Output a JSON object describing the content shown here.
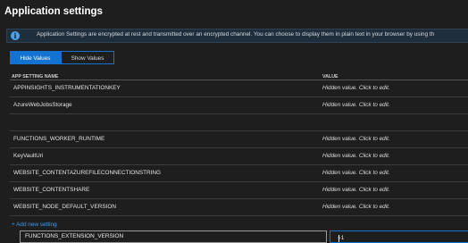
{
  "header": {
    "title": "Application settings"
  },
  "info_bar": {
    "icon": "info-icon",
    "text": "Application Settings are encrypted at rest and transmitted over an encrypted channel. You can choose to display them in plain text in your browser by using th"
  },
  "toggle": {
    "hide_label": "Hide Values",
    "show_label": "Show Values",
    "selected": "Hide Values"
  },
  "table": {
    "columns": {
      "name": "APP SETTING NAME",
      "value": "VALUE"
    },
    "rows": [
      {
        "name": "APPINSIGHTS_INSTRUMENTATIONKEY",
        "value": "Hidden value. Click to edit."
      },
      {
        "name": "AzureWebJobsStorage",
        "value": "Hidden value. Click to edit."
      },
      {
        "name": "FUNCTIONS_EXTENSION_VERSION",
        "value": "~1"
      },
      {
        "name": "FUNCTIONS_WORKER_RUNTIME",
        "value": "Hidden value. Click to edit."
      },
      {
        "name": "KeyVaultUri",
        "value": "Hidden value. Click to edit."
      },
      {
        "name": "WEBSITE_CONTENTAZUREFILECONNECTIONSTRING",
        "value": "Hidden value. Click to edit."
      },
      {
        "name": "WEBSITE_CONTENTSHARE",
        "value": "Hidden value. Click to edit."
      },
      {
        "name": "WEBSITE_NODE_DEFAULT_VERSION",
        "value": "Hidden value. Click to edit."
      }
    ]
  },
  "add_setting_label": "+ Add new setting",
  "colors": {
    "background": "#1e1e1e",
    "accent": "#1473d0",
    "info_background": "#1f2d3c",
    "link": "#3e9cf2"
  }
}
